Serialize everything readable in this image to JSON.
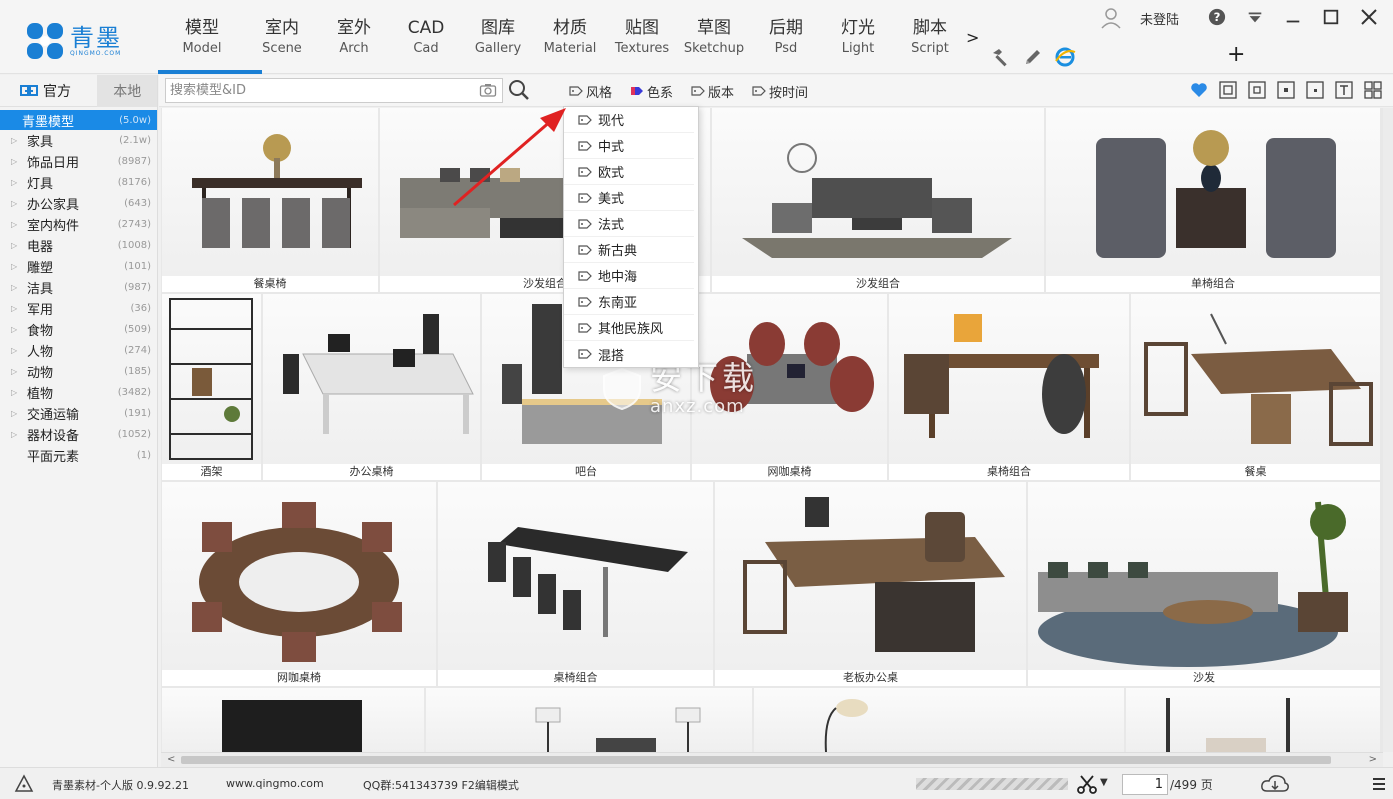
{
  "app": {
    "logo_name": "青墨",
    "logo_sub": "QINGMO.COM",
    "brand_color": "#1a7fd4"
  },
  "nav": {
    "tabs": [
      {
        "zh": "模型",
        "en": "Model"
      },
      {
        "zh": "室内",
        "en": "Scene"
      },
      {
        "zh": "室外",
        "en": "Arch"
      },
      {
        "zh": "CAD",
        "en": "Cad"
      },
      {
        "zh": "图库",
        "en": "Gallery"
      },
      {
        "zh": "材质",
        "en": "Material"
      },
      {
        "zh": "贴图",
        "en": "Textures"
      },
      {
        "zh": "草图",
        "en": "Sketchup"
      },
      {
        "zh": "后期",
        "en": "Psd"
      },
      {
        "zh": "灯光",
        "en": "Light"
      },
      {
        "zh": "脚本",
        "en": "Script"
      }
    ],
    "more": ">",
    "active_index": 0
  },
  "user": {
    "label": "未登陆"
  },
  "sidebar": {
    "tab_official": "官方",
    "tab_local": "本地",
    "categories": [
      {
        "name": "青墨模型",
        "count": "(5.0w)"
      },
      {
        "name": "家具",
        "count": "(2.1w)"
      },
      {
        "name": "饰品日用",
        "count": "(8987)"
      },
      {
        "name": "灯具",
        "count": "(8176)"
      },
      {
        "name": "办公家具",
        "count": "(643)"
      },
      {
        "name": "室内构件",
        "count": "(2743)"
      },
      {
        "name": "电器",
        "count": "(1008)"
      },
      {
        "name": "雕塑",
        "count": "(101)"
      },
      {
        "name": "洁具",
        "count": "(987)"
      },
      {
        "name": "军用",
        "count": "(36)"
      },
      {
        "name": "食物",
        "count": "(509)"
      },
      {
        "name": "人物",
        "count": "(274)"
      },
      {
        "name": "动物",
        "count": "(185)"
      },
      {
        "name": "植物",
        "count": "(3482)"
      },
      {
        "name": "交通运输",
        "count": "(191)"
      },
      {
        "name": "器材设备",
        "count": "(1052)"
      },
      {
        "name": "平面元素",
        "count": "(1)"
      }
    ]
  },
  "search": {
    "placeholder": "搜索模型&ID",
    "value": ""
  },
  "filters": {
    "style": "风格",
    "color": "色系",
    "version": "版本",
    "time": "按时间"
  },
  "style_menu": {
    "items": [
      "现代",
      "中式",
      "欧式",
      "美式",
      "法式",
      "新古典",
      "地中海",
      "东南亚",
      "其他民族风",
      "混搭"
    ]
  },
  "grid": {
    "captions": [
      "餐桌椅",
      "沙发组合",
      "沙发组合",
      "单椅组合",
      "酒架",
      "办公桌椅",
      "吧台",
      "网咖桌椅",
      "桌椅组合",
      "餐桌",
      "网咖桌椅",
      "桌椅组合",
      "老板办公桌",
      "沙发"
    ]
  },
  "watermark": {
    "big": "安下载",
    "small": "anxz.com"
  },
  "status": {
    "edition": "青墨素材-个人版 0.9.92.21",
    "website": "www.qingmo.com",
    "qq": "QQ群:541343739 F2编辑模式",
    "page_current": "1",
    "page_total": "/499 页"
  }
}
